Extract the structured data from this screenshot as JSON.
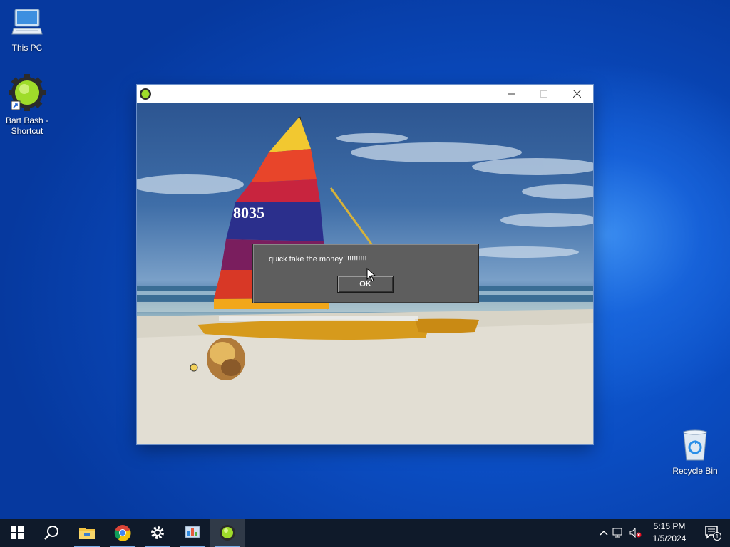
{
  "desktop": {
    "icons": [
      {
        "label": "This PC"
      },
      {
        "label": "Bart Bash - Shortcut"
      },
      {
        "label": "Recycle Bin"
      }
    ]
  },
  "window": {
    "title": "",
    "sail_number": "8035",
    "dialog": {
      "message": "quick take the money!!!!!!!!!!!",
      "ok_label": "OK"
    }
  },
  "taskbar": {
    "apps": [
      "start-icon",
      "search-icon",
      "file-explorer-icon",
      "chrome-icon",
      "settings-icon",
      "control-panel-icon",
      "bart-bash-icon"
    ],
    "clock": {
      "time": "5:15 PM",
      "date": "1/5/2024"
    },
    "notification_count": "1"
  },
  "colors": {
    "desktop_blue": "#0b4ec4",
    "taskbar": "#0f1a2a",
    "dialog_gray": "#5e5e5e"
  }
}
